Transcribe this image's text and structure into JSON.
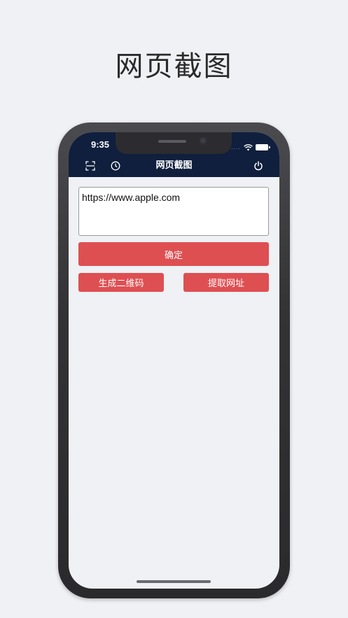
{
  "headline": "网页截图",
  "status_bar": {
    "time": "9:35",
    "signal_dots": "....",
    "icons": [
      "wifi-icon",
      "battery-icon"
    ]
  },
  "nav": {
    "title": "网页截图",
    "left_icons": [
      "scan-icon",
      "history-clock-icon"
    ],
    "right_icon": "power-icon"
  },
  "form": {
    "url_value": "https://www.apple.com",
    "confirm_label": "确定",
    "generate_qr_label": "生成二维码",
    "extract_url_label": "提取网址"
  },
  "colors": {
    "nav_background": "#0f1f3d",
    "button": "#de4f52",
    "page_background": "#f0f1f5"
  }
}
